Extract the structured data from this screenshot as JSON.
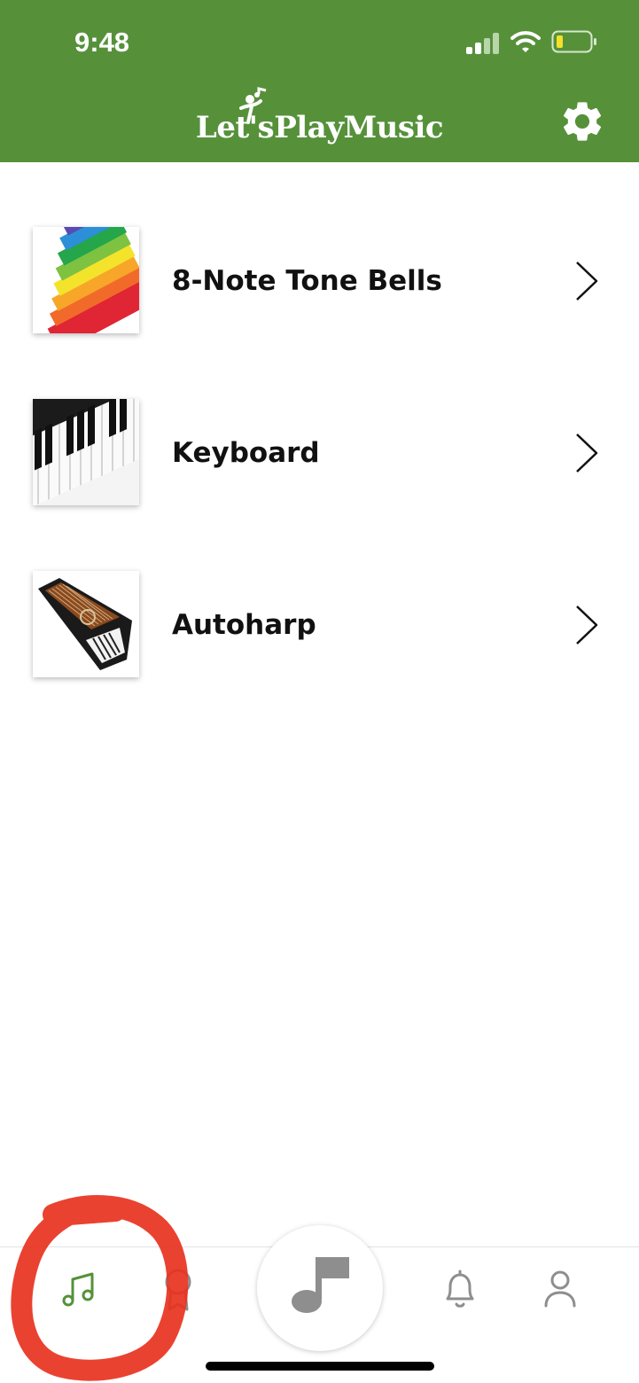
{
  "status_bar": {
    "time": "9:48",
    "icons": [
      "signal-icon",
      "wifi-icon",
      "battery-icon"
    ]
  },
  "header": {
    "logo_text": "Let'sPlayMusic",
    "settings_icon": "gear-icon",
    "background": "#56913a"
  },
  "instruments": [
    {
      "label": "8-Note Tone Bells",
      "thumb": "tone-bells-image"
    },
    {
      "label": "Keyboard",
      "thumb": "keyboard-image"
    },
    {
      "label": "Autoharp",
      "thumb": "autoharp-image"
    }
  ],
  "bottom_nav": {
    "items": [
      {
        "icon": "music-notes-icon",
        "active": true
      },
      {
        "icon": "award-ribbon-icon",
        "active": false
      },
      {
        "icon": "music-note-center-icon",
        "active": false
      },
      {
        "icon": "bell-icon",
        "active": false
      },
      {
        "icon": "user-icon",
        "active": false
      }
    ],
    "active_color": "#56913a",
    "inactive_color": "#8e8e8e"
  }
}
